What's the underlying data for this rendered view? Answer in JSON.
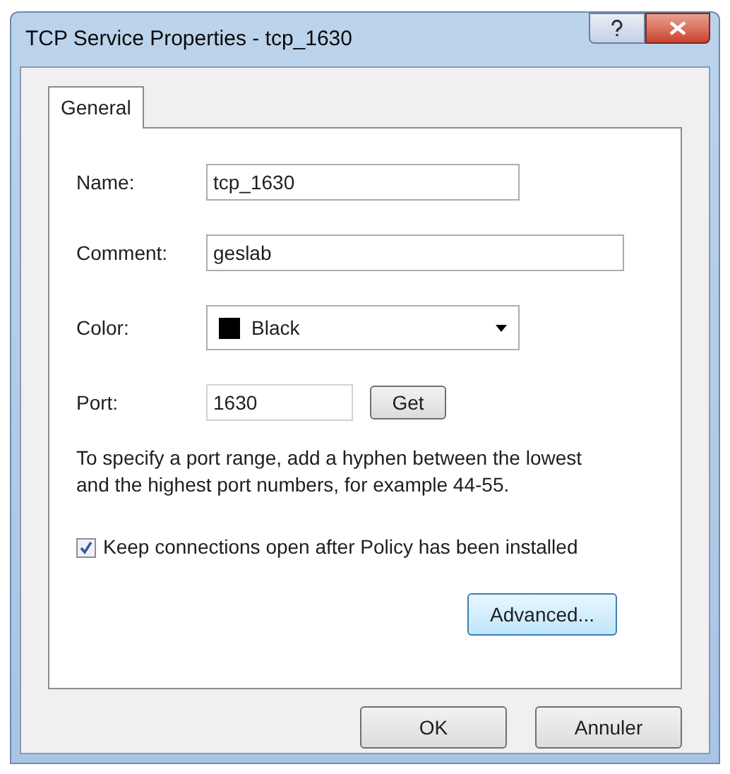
{
  "window": {
    "title": "TCP Service Properties - tcp_1630"
  },
  "tabs": [
    {
      "label": "General",
      "selected": true
    }
  ],
  "fields": [
    {
      "kind": "text",
      "label": "Name:",
      "value": "tcp_1630",
      "wide": false
    },
    {
      "kind": "text",
      "label": "Comment:",
      "value": "geslab",
      "wide": true
    },
    {
      "kind": "dropdown",
      "label": "Color:",
      "value": "Black",
      "color": "#000000"
    },
    {
      "kind": "port",
      "label": "Port:",
      "value": "1630",
      "button": "Get"
    }
  ],
  "note": "To specify a port range, add a hyphen between the lowest and the highest port numbers, for example 44-55.",
  "checkbox": {
    "label": "Keep connections open after Policy has been installed",
    "checked": true
  },
  "advanced_button": "Advanced...",
  "buttons": [
    "OK",
    "Annuler"
  ]
}
